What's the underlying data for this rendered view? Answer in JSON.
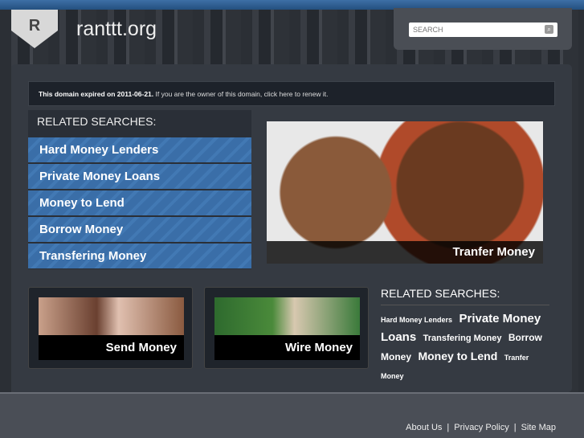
{
  "header": {
    "logo_letter": "R",
    "site_title": "ranttt.org",
    "search_placeholder": "SEARCH"
  },
  "notice": {
    "bold": "This domain expired on 2011-06-21.",
    "text": " If you are the owner of this domain, click here to renew it."
  },
  "related_left": {
    "heading": "RELATED SEARCHES:",
    "items": [
      "Hard Money Lenders",
      "Private Money Loans",
      "Money to Lend",
      "Borrow Money",
      "Transfering Money"
    ]
  },
  "featured": {
    "caption": "Tranfer Money"
  },
  "cards": [
    {
      "label": "Send Money"
    },
    {
      "label": "Wire Money"
    }
  ],
  "related_right": {
    "heading": "RELATED SEARCHES:",
    "items": [
      "Hard Money Lenders",
      "Private Money Loans",
      "Transfering Money",
      "Borrow Money",
      "Money to Lend",
      "Tranfer Money"
    ]
  },
  "footer": {
    "links": [
      "About Us",
      "Privacy Policy",
      "Site Map"
    ]
  },
  "colors": {
    "accent": "#3a6ea8",
    "topbar": "#2f5f94"
  }
}
